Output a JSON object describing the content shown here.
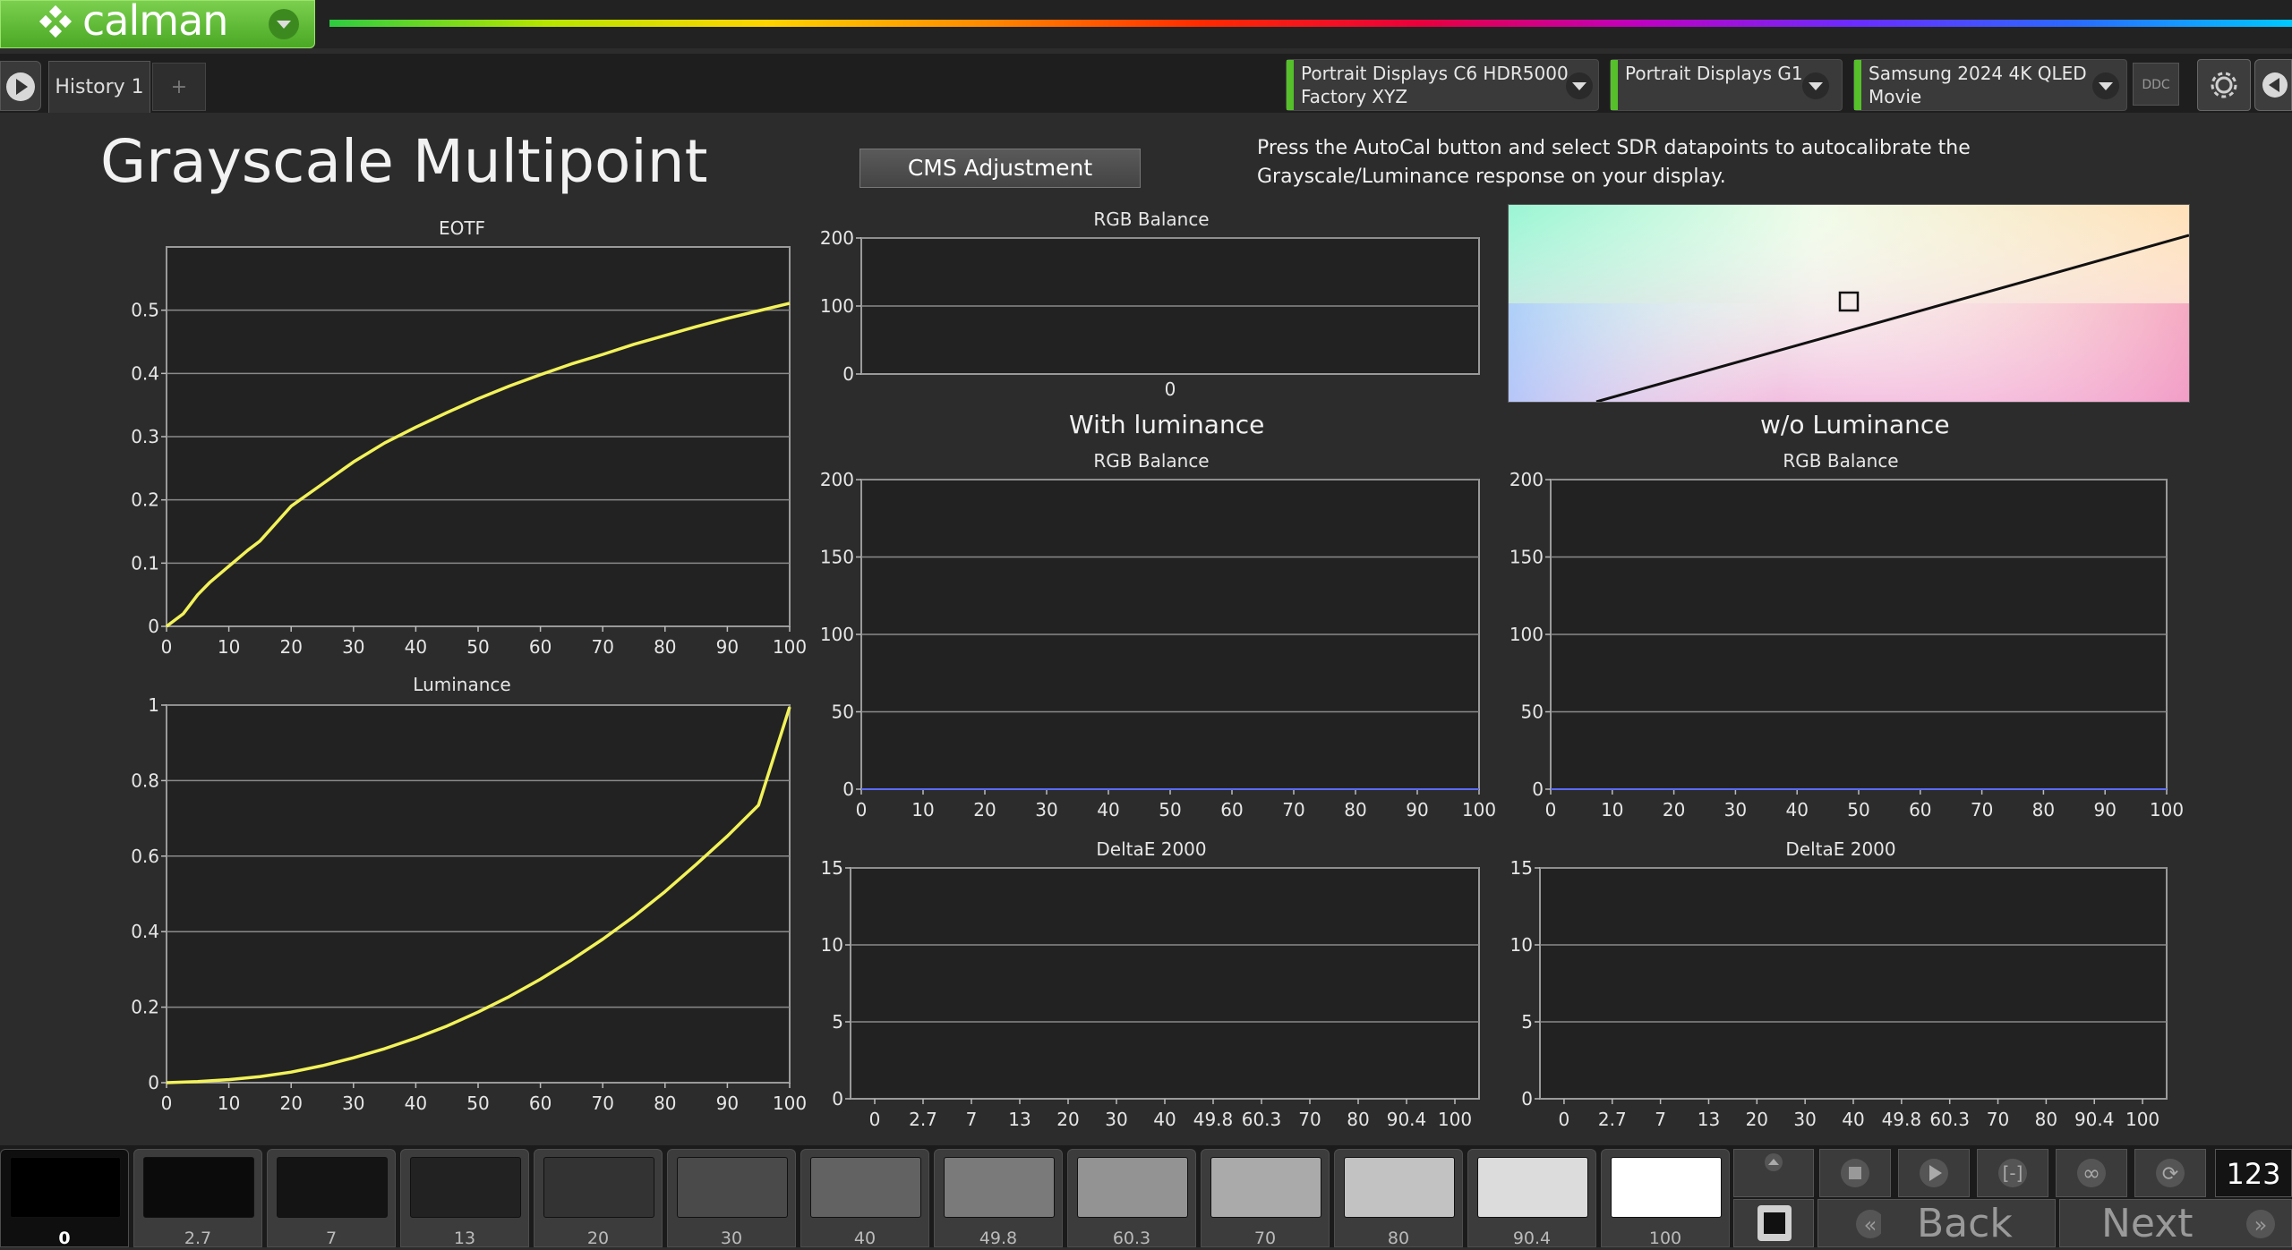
{
  "app": {
    "logo_text": "calman",
    "history_tab": "History 1",
    "add_tab": "+"
  },
  "devices": [
    {
      "line1": "Portrait Displays C6 HDR5000",
      "line2": "Factory XYZ"
    },
    {
      "line1": "Portrait Displays G1",
      "line2": ""
    },
    {
      "line1": "Samsung 2024 4K QLED",
      "line2": "Movie"
    }
  ],
  "toolbar": {
    "ddc_label": "DDC"
  },
  "page": {
    "title": "Grayscale Multipoint",
    "cms_button": "CMS Adjustment",
    "instructions": "Press the AutoCal button and select SDR datapoints to autocalibrate the Grayscale/Luminance response on your display.",
    "with_luminance": "With luminance",
    "without_luminance": "w/o Luminance"
  },
  "colors": {
    "curve": "#f2f25a",
    "grid": "#8a8a8a",
    "plot_bg": "#222222",
    "flat_line": "#5a6cff",
    "accent_green": "#55c02a"
  },
  "chart_data": [
    {
      "id": "eotf",
      "type": "line",
      "title": "EOTF",
      "xlim": [
        0,
        100
      ],
      "ylim": [
        0,
        0.6
      ],
      "x_ticks": [
        0,
        10,
        20,
        30,
        40,
        50,
        60,
        70,
        80,
        90,
        100
      ],
      "y_ticks": [
        0,
        0.1,
        0.2,
        0.3,
        0.4,
        0.5
      ],
      "y_tick_labels": [
        "0",
        "0.1",
        "0.2",
        "0.3",
        "0.4",
        "0.5"
      ],
      "x": [
        0,
        2.7,
        5,
        7,
        10,
        13,
        15,
        20,
        25,
        30,
        35,
        40,
        45,
        50,
        55,
        60,
        65,
        70,
        75,
        80,
        85,
        90,
        95,
        100
      ],
      "y": [
        0,
        0.02,
        0.05,
        0.07,
        0.095,
        0.12,
        0.135,
        0.19,
        0.225,
        0.26,
        0.29,
        0.315,
        0.338,
        0.36,
        0.38,
        0.398,
        0.415,
        0.43,
        0.446,
        0.46,
        0.474,
        0.487,
        0.499,
        0.511
      ]
    },
    {
      "id": "luminance",
      "type": "line",
      "title": "Luminance",
      "xlim": [
        0,
        100
      ],
      "ylim": [
        0,
        1
      ],
      "x_ticks": [
        0,
        10,
        20,
        30,
        40,
        50,
        60,
        70,
        80,
        90,
        100
      ],
      "y_ticks": [
        0,
        0.2,
        0.4,
        0.6,
        0.8,
        1
      ],
      "y_tick_labels": [
        "0",
        "0.2",
        "0.4",
        "0.6",
        "0.8",
        "1"
      ],
      "x": [
        0,
        5,
        10,
        15,
        20,
        25,
        30,
        35,
        40,
        45,
        50,
        55,
        60,
        65,
        70,
        75,
        80,
        85,
        90,
        95,
        100
      ],
      "y": [
        0,
        0.003,
        0.008,
        0.016,
        0.028,
        0.045,
        0.066,
        0.09,
        0.118,
        0.15,
        0.187,
        0.228,
        0.274,
        0.325,
        0.38,
        0.44,
        0.506,
        0.578,
        0.653,
        0.735,
        0.995
      ]
    },
    {
      "id": "rgb-balance-top",
      "type": "line",
      "title": "RGB Balance",
      "ylim": [
        0,
        200
      ],
      "y_ticks": [
        0,
        100,
        200
      ],
      "y_tick_labels": [
        "0",
        "100",
        "200"
      ],
      "x_tick_labels": [
        "0"
      ]
    },
    {
      "id": "rgb-balance-with",
      "type": "line",
      "title": "RGB Balance",
      "xlim": [
        0,
        100
      ],
      "ylim": [
        0,
        200
      ],
      "x_ticks": [
        0,
        10,
        20,
        30,
        40,
        50,
        60,
        70,
        80,
        90,
        100
      ],
      "y_ticks": [
        0,
        50,
        100,
        150,
        200
      ],
      "y_tick_labels": [
        "0",
        "50",
        "100",
        "150",
        "200"
      ],
      "x": [
        0,
        100
      ],
      "y": [
        0,
        0
      ]
    },
    {
      "id": "rgb-balance-without",
      "type": "line",
      "title": "RGB Balance",
      "xlim": [
        0,
        100
      ],
      "ylim": [
        0,
        200
      ],
      "x_ticks": [
        0,
        10,
        20,
        30,
        40,
        50,
        60,
        70,
        80,
        90,
        100
      ],
      "y_ticks": [
        0,
        50,
        100,
        150,
        200
      ],
      "y_tick_labels": [
        "0",
        "50",
        "100",
        "150",
        "200"
      ],
      "x": [
        0,
        100
      ],
      "y": [
        0,
        0
      ]
    },
    {
      "id": "deltae-with",
      "type": "bar",
      "title": "DeltaE 2000",
      "ylim": [
        0,
        15
      ],
      "y_ticks": [
        0,
        5,
        10,
        15
      ],
      "y_tick_labels": [
        "0",
        "5",
        "10",
        "15"
      ],
      "categories": [
        "0",
        "2.7",
        "7",
        "13",
        "20",
        "30",
        "40",
        "49.8",
        "60.3",
        "70",
        "80",
        "90.4",
        "100"
      ]
    },
    {
      "id": "deltae-without",
      "type": "bar",
      "title": "DeltaE 2000",
      "ylim": [
        0,
        15
      ],
      "y_ticks": [
        0,
        5,
        10,
        15
      ],
      "y_tick_labels": [
        "0",
        "5",
        "10",
        "15"
      ],
      "categories": [
        "0",
        "2.7",
        "7",
        "13",
        "20",
        "30",
        "40",
        "49.8",
        "60.3",
        "70",
        "80",
        "90.4",
        "100"
      ]
    }
  ],
  "patches": [
    {
      "label": "0",
      "color": "#000000"
    },
    {
      "label": "2.7",
      "color": "#0b0b0b"
    },
    {
      "label": "7",
      "color": "#141414"
    },
    {
      "label": "13",
      "color": "#222222"
    },
    {
      "label": "20",
      "color": "#333333"
    },
    {
      "label": "30",
      "color": "#4a4a4a"
    },
    {
      "label": "40",
      "color": "#626262"
    },
    {
      "label": "49.8",
      "color": "#7a7a7a"
    },
    {
      "label": "60.3",
      "color": "#939393"
    },
    {
      "label": "70",
      "color": "#aaaaaa"
    },
    {
      "label": "80",
      "color": "#c2c2c2"
    },
    {
      "label": "90.4",
      "color": "#dcdcdc"
    },
    {
      "label": "100",
      "color": "#ffffff"
    }
  ],
  "controls": {
    "back": "Back",
    "next": "Next",
    "counter": "123"
  }
}
